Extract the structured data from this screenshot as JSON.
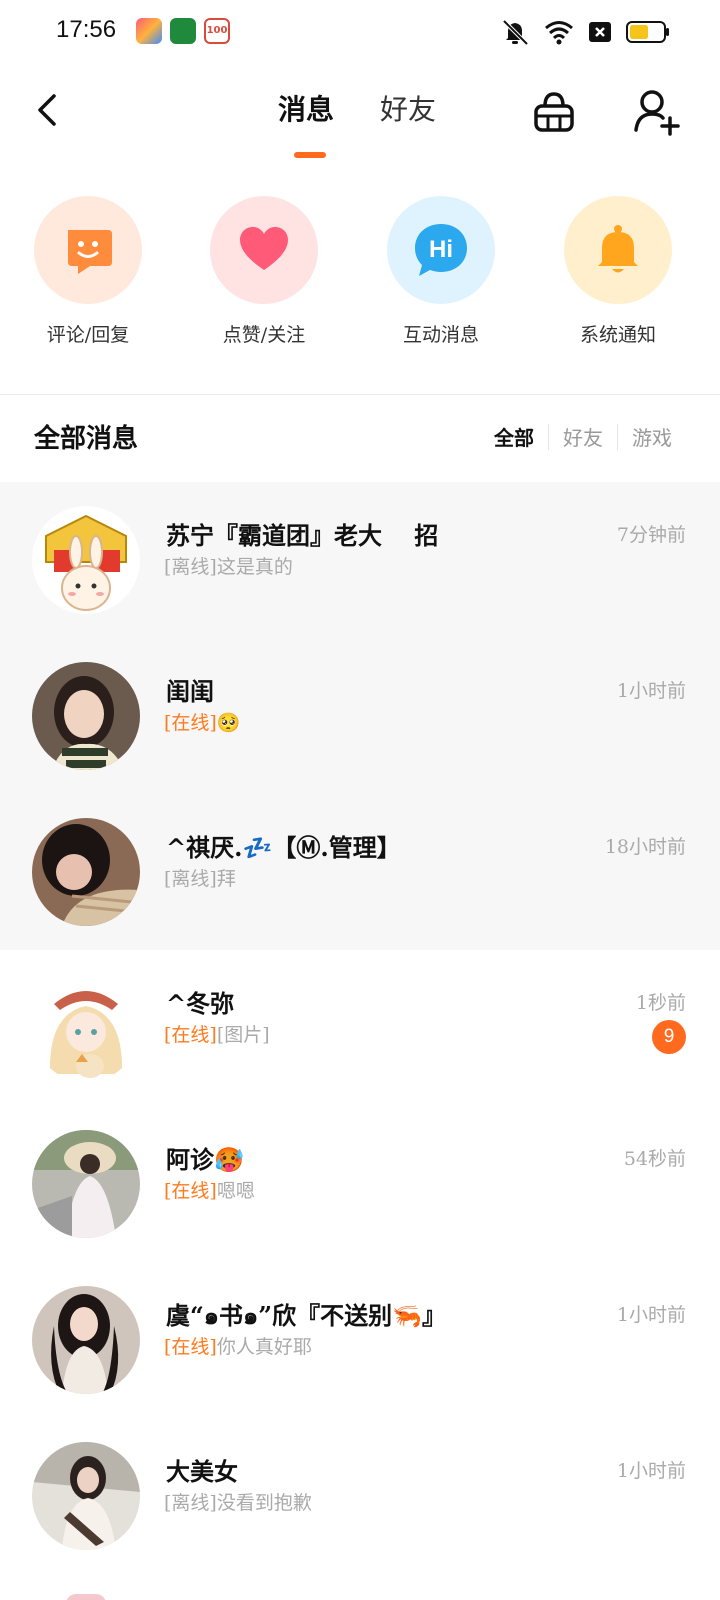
{
  "status_bar": {
    "time": "17:56"
  },
  "nav": {
    "tabs": [
      {
        "label": "消息"
      },
      {
        "label": "好友"
      }
    ]
  },
  "categories": [
    {
      "label": "评论/回复",
      "icon": "smile-chat-icon",
      "bg": "#ffe9dc",
      "color": "#ff8b3d"
    },
    {
      "label": "点赞/关注",
      "icon": "heart-icon",
      "bg": "#ffe3e3",
      "color": "#ff5a78"
    },
    {
      "label": "互动消息",
      "icon": "hi-bubble-icon",
      "bg": "#dff3ff",
      "color": "#2ba8ee"
    },
    {
      "label": "系统通知",
      "icon": "bell-icon",
      "bg": "#ffefcc",
      "color": "#ffa51e"
    }
  ],
  "section": {
    "title": "全部消息",
    "filters": [
      {
        "label": "全部"
      },
      {
        "label": "好友"
      },
      {
        "label": "游戏"
      }
    ]
  },
  "conversations": [
    {
      "name": "苏宁『霸道团』老大　 招",
      "status": "[离线]",
      "online": false,
      "message": "这是真的",
      "time": "7分钟前",
      "unread": "",
      "pinned": true
    },
    {
      "name": "闺闺",
      "status": "[在线]",
      "online": true,
      "message": "🥺",
      "time": "1小时前",
      "unread": "",
      "pinned": true
    },
    {
      "name": "^祺厌.💤【Ⓜ.管理】",
      "status": "[离线]",
      "online": false,
      "message": "拜",
      "time": "18小时前",
      "unread": "",
      "pinned": true
    },
    {
      "name": "^冬弥",
      "status": "[在线]",
      "online": true,
      "message": "[图片]",
      "time": "1秒前",
      "unread": "9",
      "pinned": false
    },
    {
      "name": "阿诊🥵",
      "status": "[在线]",
      "online": true,
      "message": "嗯嗯",
      "time": "54秒前",
      "unread": "",
      "pinned": false
    },
    {
      "name": "虞“๑书๑”欣『不送别🦐』",
      "status": "[在线]",
      "online": true,
      "message": "你人真好耶",
      "time": "1小时前",
      "unread": "",
      "pinned": false
    },
    {
      "name": "大美女",
      "status": "[离线]",
      "online": false,
      "message": "没看到抱歉",
      "time": "1小时前",
      "unread": "",
      "pinned": false
    }
  ],
  "colors": {
    "accent": "#ff6a1f",
    "online": "#ff7a1e",
    "muted": "#aaaaaa"
  }
}
